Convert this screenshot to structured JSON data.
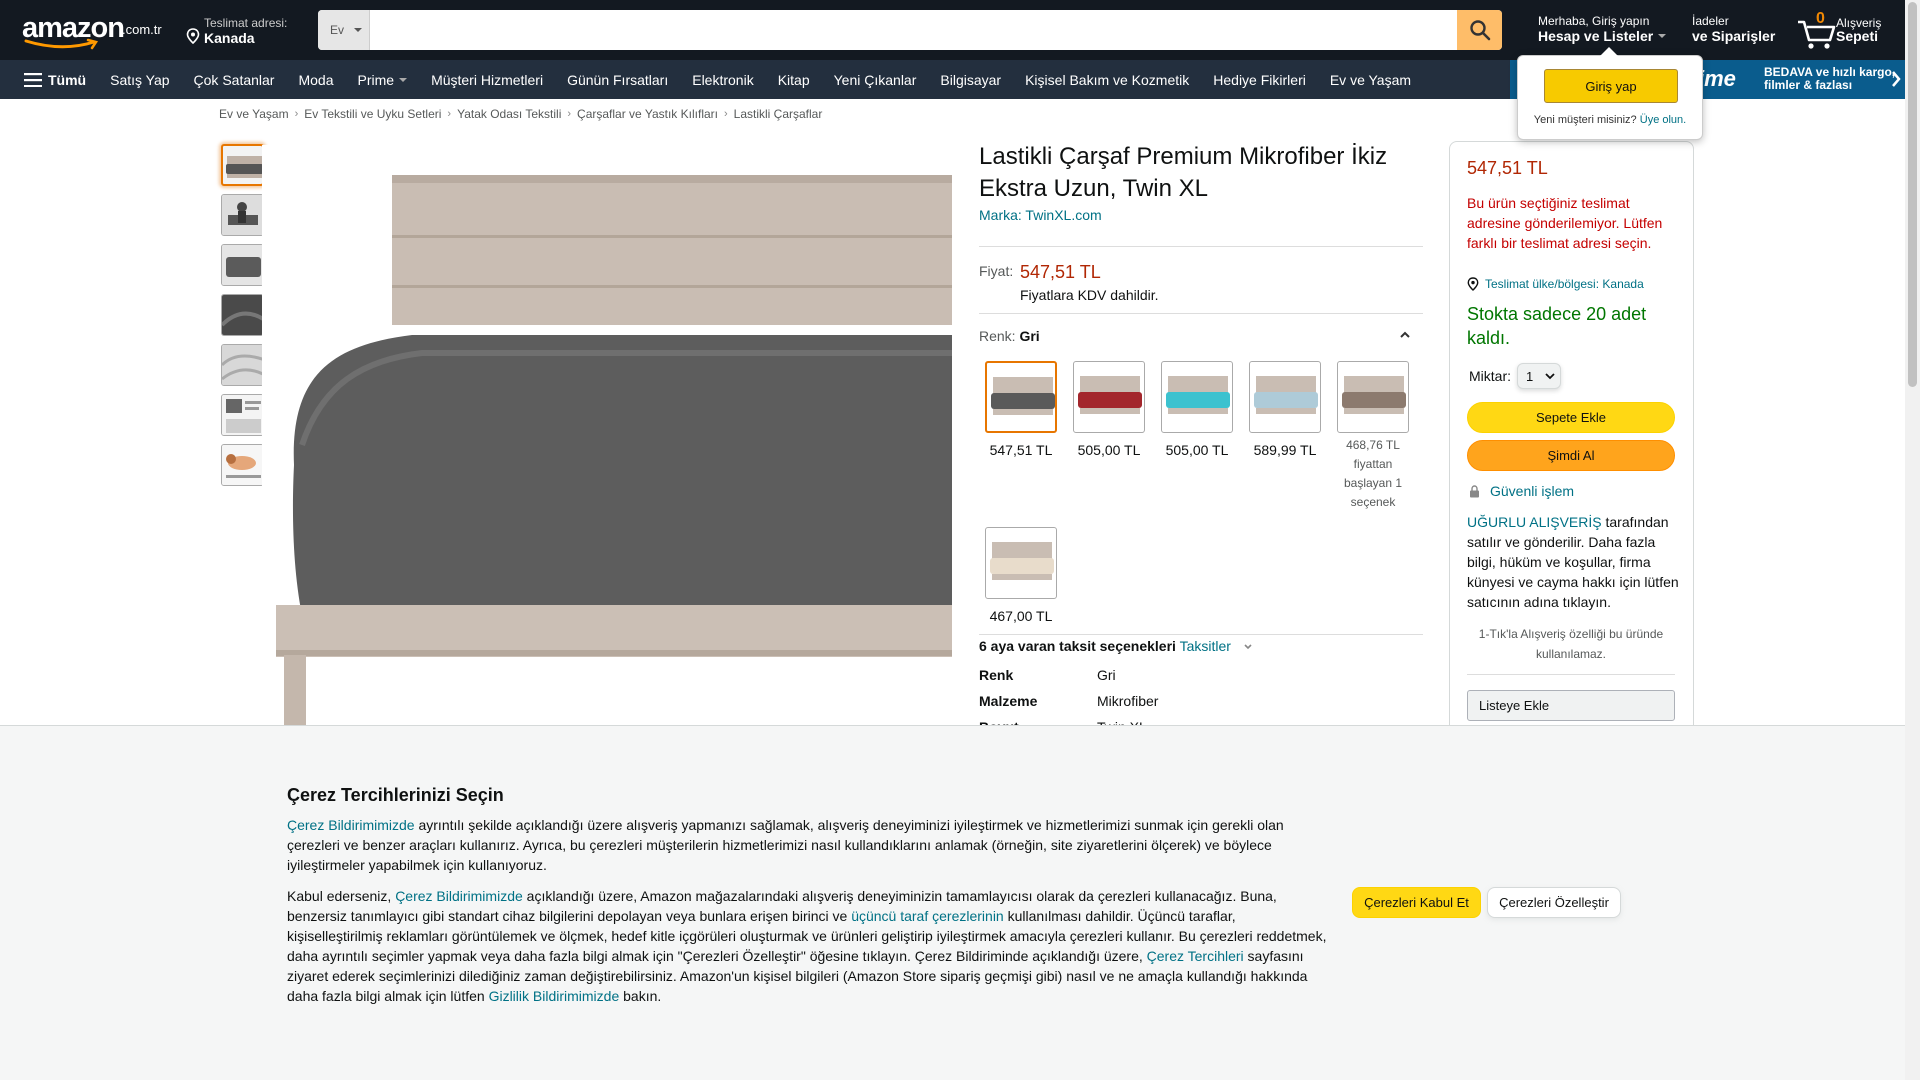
{
  "header": {
    "logo_text": "amazon",
    "logo_tld": ".com.tr",
    "deliver_line1": "Teslimat adresi:",
    "deliver_line2": "Kanada",
    "search_category": "Ev",
    "search_placeholder": "",
    "account_line1": "Merhaba, Giriş yapın",
    "account_line2": "Hesap ve Listeler",
    "orders_line1": "İadeler",
    "orders_line2": "ve Siparişler",
    "cart_count": "0",
    "cart_line1": "Alışveriş",
    "cart_line2": "Sepeti"
  },
  "subnav": {
    "all_label": "Tümü",
    "items": [
      "Satış Yap",
      "Çok Satanlar",
      "Moda",
      "Prime",
      "Müşteri Hizmetleri",
      "Günün Fırsatları",
      "Elektronik",
      "Kitap",
      "Yeni Çıkanlar",
      "Bilgisayar",
      "Kişisel Bakım ve Kozmetik",
      "Hediye Fikirleri",
      "Ev ve Yaşam"
    ],
    "prime_word": "prime",
    "prime_tagline_1": "BEDAVA ve hızlı kargo,",
    "prime_tagline_2": "filmler & fazlası"
  },
  "signin_popover": {
    "button_label": "Giriş yap",
    "new_customer": "Yeni müşteri misiniz?",
    "register_link": "Üye olun."
  },
  "breadcrumb": [
    "Ev ve Yaşam",
    "Ev Tekstili ve Uyku Setleri",
    "Yatak Odası Tekstili",
    "Çarşaflar ve Yastık Kılıfları",
    "Lastikli Çarşaflar"
  ],
  "product": {
    "title": "Lastikli Çarşaf Premium Mikrofiber İkiz Ekstra Uzun, Twin XL",
    "brand": "Marka: TwinXL.com",
    "price_label": "Fiyat:",
    "price": "547,51 TL",
    "price_note": "Fiyatlara KDV dahildir.",
    "color_label": "Renk:",
    "color_value": "Gri",
    "swatches": [
      {
        "price": "547,51 TL",
        "color": "#5a5a5a"
      },
      {
        "price": "505,00 TL",
        "color": "#a3262c"
      },
      {
        "price": "505,00 TL",
        "color": "#3cc2cf"
      },
      {
        "price": "589,99 TL",
        "color": "#aecbd8"
      },
      {
        "price_line1": "468,76 TL",
        "price_line2": "fiyattan",
        "price_line3": "başlayan 1",
        "price_line4": "seçenek",
        "color": "#8c7a6e"
      },
      {
        "price": "467,00 TL",
        "color": "#e8dccb"
      }
    ],
    "installment_bold": "6 aya varan taksit seçenekleri",
    "installment_link": "Taksitler",
    "specs": [
      {
        "k": "Renk",
        "v": "Gri"
      },
      {
        "k": "Malzeme",
        "v": "Mikrofiber"
      },
      {
        "k": "Boyut",
        "v": "Twin XL"
      }
    ]
  },
  "buybox": {
    "price": "547,51 TL",
    "warning": "Bu ürün seçtiğiniz teslimat adresine gönderilemiyor. Lütfen farklı bir teslimat adresi seçin.",
    "location": "Teslimat ülke/bölgesi: Kanada",
    "stock": "Stokta sadece 20 adet kaldı.",
    "qty_label": "Miktar:",
    "qty_value": "1",
    "add_to_cart": "Sepete Ekle",
    "buy_now": "Şimdi Al",
    "secure": "Güvenli işlem",
    "seller_name": "UĞURLU ALIŞVERİŞ",
    "seller_text": " tarafından satılır ve gönderilir. Daha fazla bilgi, hüküm ve koşullar, firma künyesi ve cayma hakkı için lütfen satıcının adına tıklayın.",
    "oneclick": "1-Tık'la Alışveriş özelliği bu üründe kullanılamaz.",
    "add_to_list": "Listeye Ekle"
  },
  "cookie": {
    "title": "Çerez Tercihlerinizi Seçin",
    "p1_link1": "Çerez Bildirimimizde",
    "p1_text": " ayrıntılı şekilde açıklandığı üzere alışveriş yapmanızı sağlamak, alışveriş deneyiminizi iyileştirmek ve hizmetlerimizi sunmak için gerekli olan çerezleri ve benzer araçları kullanırız. Ayrıca, bu çerezleri müşterilerin hizmetlerimizi nasıl kullandıklarını anlamak (örneğin, site ziyaretlerini ölçerek) ve böylece iyileştirmeler yapabilmek için kullanıyoruz.",
    "p2_a": "Kabul ederseniz, ",
    "p2_link1": "Çerez Bildirimimizde",
    "p2_b": " açıklandığı üzere, Amazon mağazalarındaki alışveriş deneyiminizin tamamlayıcısı olarak da çerezleri kullanacağız. Buna, benzersiz tanımlayıcı gibi standart cihaz bilgilerini depolayan veya bunlara erişen birinci ve ",
    "p2_link2": "üçüncü taraf çerezlerinin",
    "p2_c": " kullanılması dahildir. Üçüncü taraflar, kişiselleştirilmiş reklamları görüntülemek ve ölçmek, hedef kitle içgörüleri oluşturmak ve ürünleri geliştirip iyileştirmek amacıyla çerezleri kullanır. Bu çerezleri reddetmek, daha ayrıntılı seçimler yapmak veya daha fazla bilgi almak için \"Çerezleri Özelleştir\" öğesine tıklayın. Çerez Bildiriminde açıklandığı üzere, ",
    "p2_link3": "Çerez Tercihleri",
    "p2_d": " sayfasını ziyaret ederek seçimlerinizi dilediğiniz zaman değiştirebilirsiniz. Amazon'un kişisel bilgileri (Amazon Store sipariş geçmişi gibi) nasıl ve ne amaçla kullandığı hakkında daha fazla bilgi almak için lütfen ",
    "p2_link4": "Gizlilik Bildirimimizde",
    "p2_e": " bakın.",
    "accept": "Çerezleri Kabul Et",
    "customize": "Çerezleri Özelleştir"
  },
  "colors": {
    "nav_bg": "#131921",
    "subnav_bg": "#232f3e",
    "price_red": "#b12704",
    "link": "#007185",
    "stock_green": "#007600",
    "cta_yellow": "#ffd814",
    "cta_orange": "#ffa41c"
  }
}
